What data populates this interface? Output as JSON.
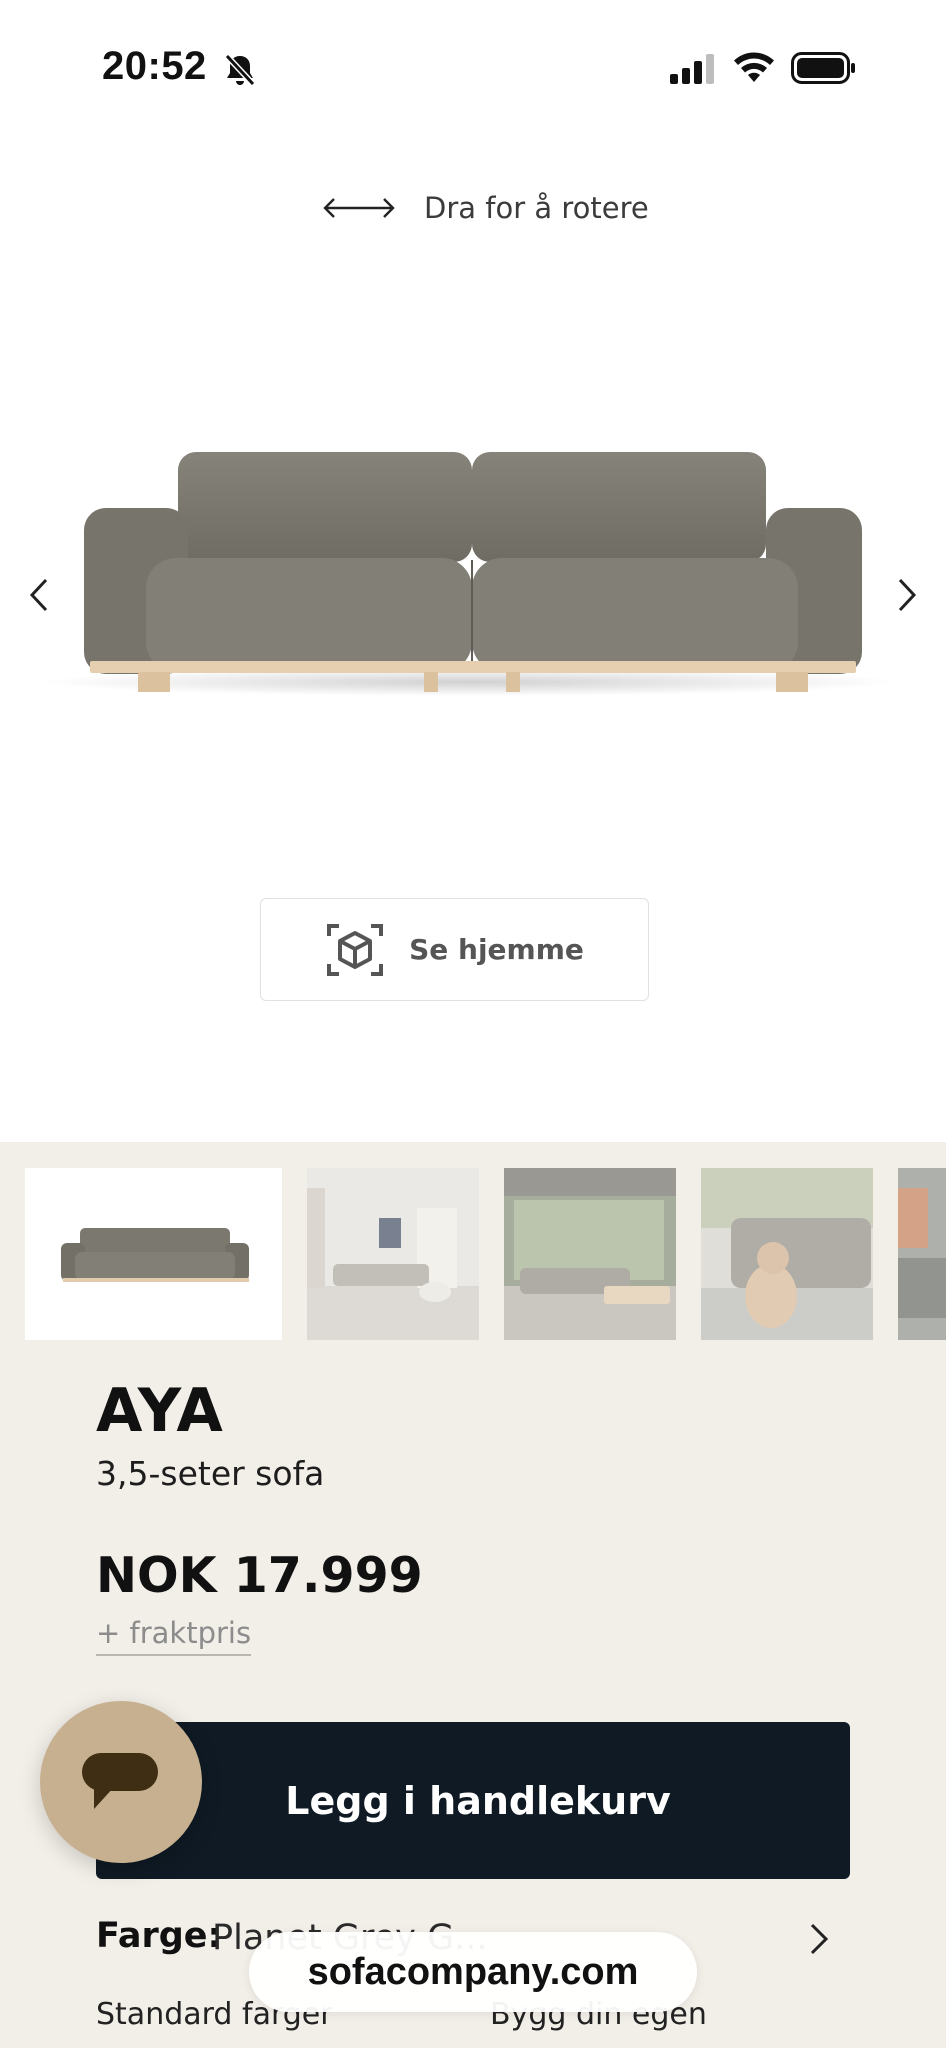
{
  "status_bar": {
    "time": "20:52",
    "icons": [
      "bell-slash-icon",
      "cellular-signal-icon",
      "wifi-icon",
      "battery-icon"
    ]
  },
  "viewer": {
    "rotate_hint": "Dra for å rotere",
    "ar_button_label": "Se hjemme"
  },
  "gallery": {
    "selected_index": 0,
    "thumbnails": [
      "studio-front",
      "room-white",
      "room-window",
      "sofa-with-dog",
      "partial"
    ]
  },
  "product": {
    "name": "AYA",
    "subtitle": "3,5-seter sofa",
    "price": "NOK 17.999",
    "shipping_note": "+ fraktpris"
  },
  "cart": {
    "add_label": "Legg i handlekurv"
  },
  "options": {
    "color_key": "Farge:",
    "color_value": "Planet Grey G...",
    "standard_colors_label": "Standard farger",
    "build_own_label": "Bygg din egen"
  },
  "browser": {
    "url": "sofacompany.com"
  },
  "colors": {
    "sofa_fabric": "#7e7b72",
    "wood_base": "#e6cfb1",
    "cta_background": "#0f1a24",
    "details_background": "#f2eee8",
    "chat_fab": "#c6b090"
  }
}
